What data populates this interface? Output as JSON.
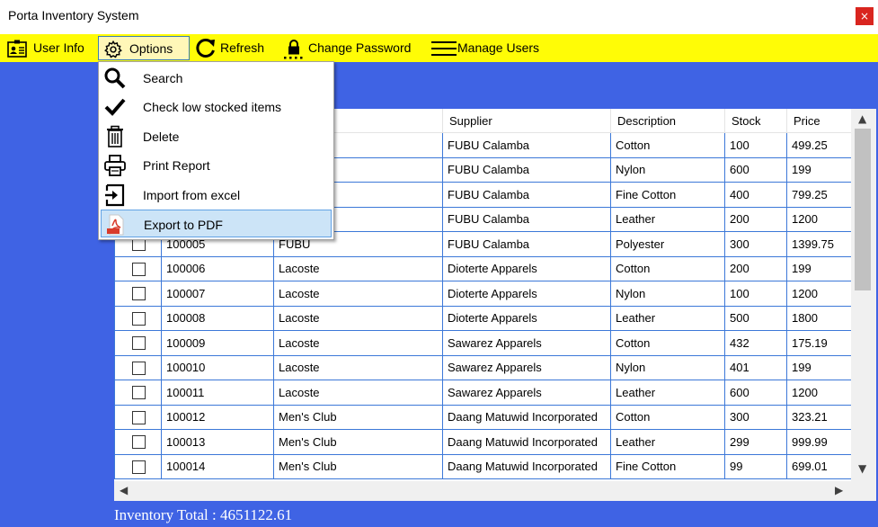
{
  "window": {
    "title": "Porta Inventory System",
    "close_glyph": "×"
  },
  "menubar": {
    "user_info": {
      "label": "User Info",
      "icon": "id-card-icon"
    },
    "options": {
      "label": "Options",
      "icon": "gear-icon"
    },
    "refresh": {
      "label": "Refresh",
      "icon": "refresh-icon"
    },
    "change_password": {
      "label": "Change Password",
      "icon": "lock-icon"
    },
    "manage_users": {
      "label": "Manage Users",
      "icon": "hamburger-icon"
    }
  },
  "options_menu": [
    {
      "label": "Search",
      "icon": "search-icon"
    },
    {
      "label": "Check low stocked items",
      "icon": "checkmark-icon"
    },
    {
      "label": "Delete",
      "icon": "trash-icon"
    },
    {
      "label": "Print Report",
      "icon": "printer-icon"
    },
    {
      "label": "Import from excel",
      "icon": "import-icon"
    },
    {
      "label": "Export to PDF",
      "icon": "pdf-icon",
      "highlighted": true
    }
  ],
  "table": {
    "columns": [
      "",
      "",
      "",
      "Supplier",
      "Description",
      "Stock",
      "Price"
    ],
    "rows": [
      [
        "",
        "",
        "",
        "FUBU Calamba",
        "Cotton",
        "100",
        "499.25"
      ],
      [
        "",
        "",
        "",
        "FUBU Calamba",
        "Nylon",
        "600",
        "199"
      ],
      [
        "",
        "",
        "",
        "FUBU Calamba",
        "Fine Cotton",
        "400",
        "799.25"
      ],
      [
        "",
        "",
        "",
        "FUBU Calamba",
        "Leather",
        "200",
        "1200"
      ],
      [
        "",
        "100005",
        "FUBU",
        "FUBU Calamba",
        "Polyester",
        "300",
        "1399.75"
      ],
      [
        "",
        "100006",
        "Lacoste",
        "Dioterte Apparels",
        "Cotton",
        "200",
        "199"
      ],
      [
        "",
        "100007",
        "Lacoste",
        "Dioterte Apparels",
        "Nylon",
        "100",
        "1200"
      ],
      [
        "",
        "100008",
        "Lacoste",
        "Dioterte Apparels",
        "Leather",
        "500",
        "1800"
      ],
      [
        "",
        "100009",
        "Lacoste",
        "Sawarez Apparels",
        "Cotton",
        "432",
        "175.19"
      ],
      [
        "",
        "100010",
        "Lacoste",
        "Sawarez Apparels",
        "Nylon",
        "401",
        "199"
      ],
      [
        "",
        "100011",
        "Lacoste",
        "Sawarez Apparels",
        "Leather",
        "600",
        "1200"
      ],
      [
        "",
        "100012",
        "Men's Club",
        "Daang Matuwid Incorporated",
        "Cotton",
        "300",
        "323.21"
      ],
      [
        "",
        "100013",
        "Men's Club",
        "Daang Matuwid Incorporated",
        "Leather",
        "299",
        "999.99"
      ],
      [
        "",
        "100014",
        "Men's Club",
        "Daang Matuwid Incorporated",
        "Fine Cotton",
        "99",
        "699.01"
      ]
    ]
  },
  "footer": {
    "total_text": "Inventory Total : 4651122.61"
  },
  "colors": {
    "background": "#3f63e4",
    "menubar": "#fffc06",
    "close": "#d9251f",
    "grid_line": "#3c78d8",
    "menu_highlight": "#cce4f7"
  }
}
